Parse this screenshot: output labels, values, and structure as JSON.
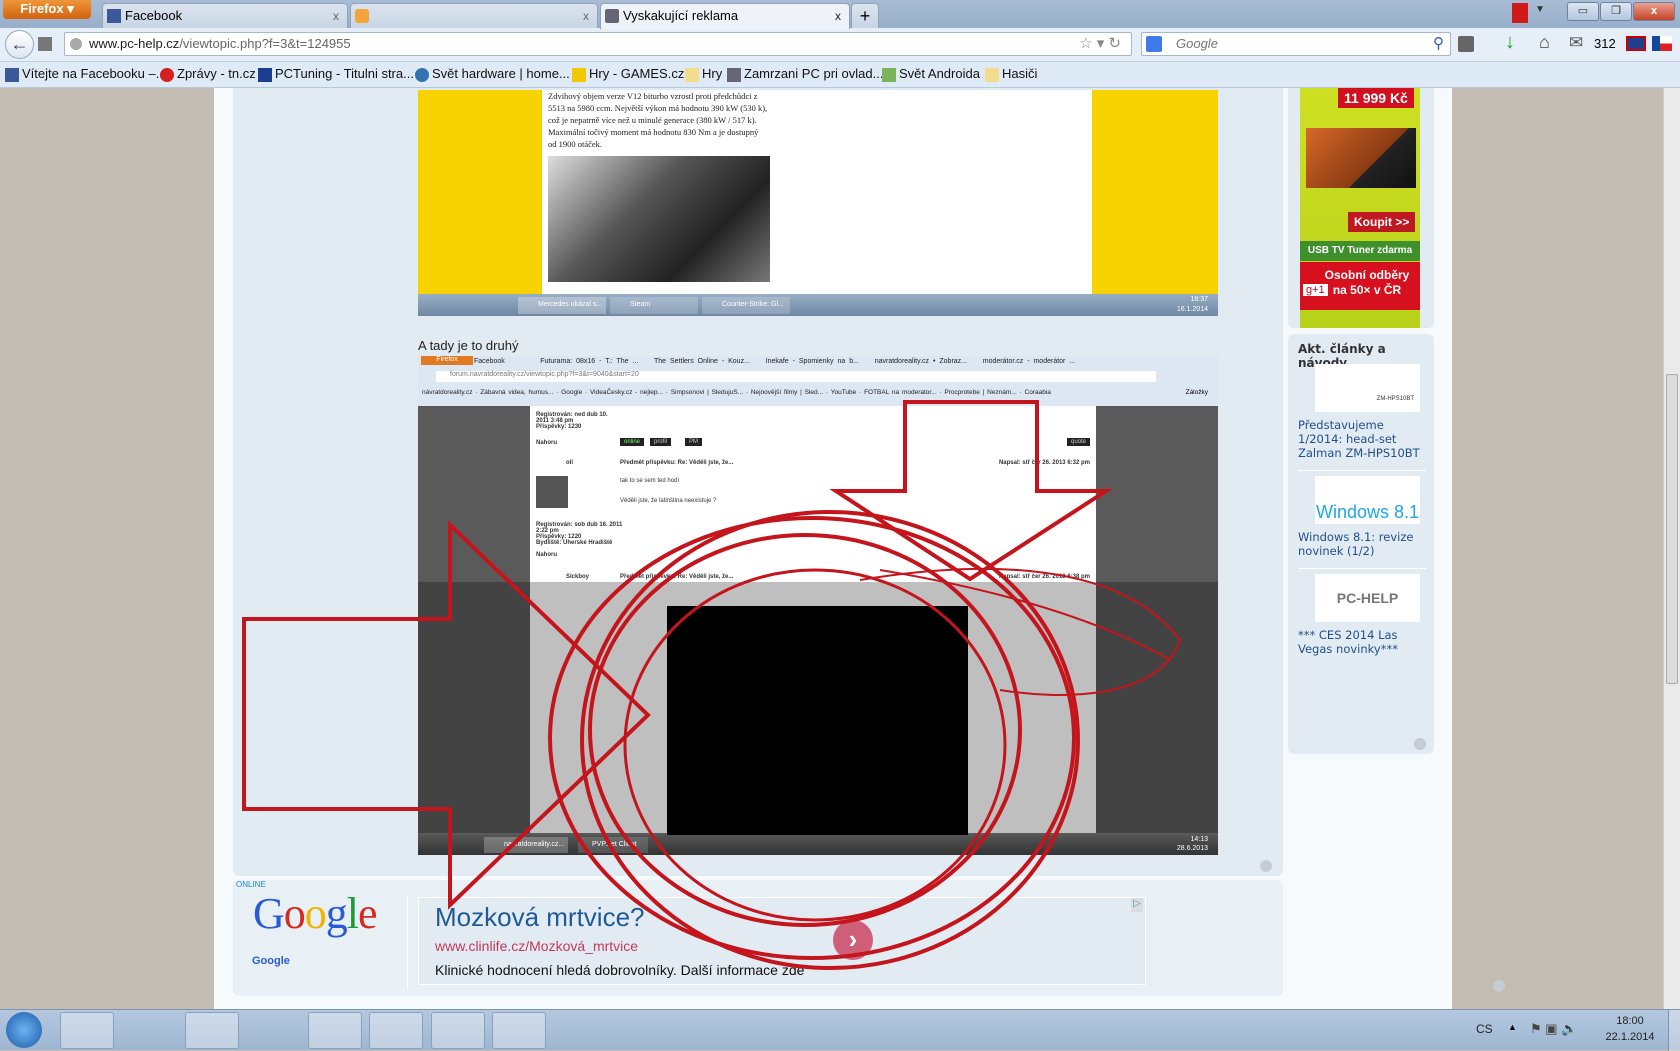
{
  "browser": {
    "menu_button": "Firefox",
    "tabs": [
      {
        "label": "Facebook"
      },
      {
        "label": ""
      },
      {
        "label": "Vyskakující reklama"
      }
    ],
    "new_tab": "+",
    "url_domain": "www.pc-help.cz",
    "url_path": "/viewtopic.php?f=3&t=124955",
    "search_placeholder": "Google",
    "mail_count": "312",
    "bookmarks": [
      "Vítejte na Facebooku –...",
      "Zprávy - tn.cz",
      "PCTuning - Titulni stra...",
      "Svět hardware | home...",
      "Hry - GAMES.cz",
      "Hry",
      "Zamrzani PC pri ovlad...",
      "Svět Androida",
      "Hasiči"
    ]
  },
  "post": {
    "shot1_text": "Zdvihový objem verze V12 biturbo vzrostl proti předchůdci z 5513 na 5980 ccm. Největší výkon má hodnotu 390 kW (530 k), což je nepatrně více než u minulé generace (380 kW / 517 k). Maximální točivý moment má hodnotu 830 Nm a je dostupný od 1900 otáček.",
    "shot1_taskbar": [
      "Mercedes ukázal s...",
      "Steam",
      "Counter-Strike: Gl..."
    ],
    "shot1_clock": "18:37",
    "shot1_date": "16.1.2014",
    "caption": "A tady je to druhý",
    "shot2_tabs": [
      "Facebook",
      "Futurama: 08x16 - T.: The ...",
      "The Settlers Online - Kouz...",
      "Inekafe - Spomienky na b...",
      "navratdoreality.cz • Zobraz...",
      "moderátor.cz - moderátor ..."
    ],
    "shot2_url": "forum.navratdoreality.cz/viewtopic.php?f=3&t=9040&start=20",
    "shot2_bookmarks": [
      "návratdoreality.cz",
      "Zábavná videa, humus...",
      "Google",
      "VideaČesky.cz - nejlep...",
      "Simpsonovi | SledujuS...",
      "Nejnovější filmy | Sled...",
      "YouTube",
      "FOTBAL na moderator...",
      "Procprotebe | Neznám...",
      "Coraabia",
      "Záložky"
    ],
    "shot2_posts": [
      {
        "author": "",
        "reg": "Registrován: ned dub 10. 2011 3:48 pm",
        "posts": "Příspěvky: 1230",
        "top": "Nahoru"
      },
      {
        "author": "oli",
        "subject": "Předmět příspěvku: Re: Věděli jste, že...",
        "date": "Napsal: stř čer 26. 2013 6:32 pm",
        "body1": "tak to se sem ted hodí",
        "body2": "Věděli jste, že latinština neexistuje ?",
        "reg": "Registrován: sob dub 16. 2011 2:22 pm",
        "posts": "Příspěvky: 1220",
        "loc": "Bydliště: Uherské Hradiště",
        "top": "Nahoru"
      },
      {
        "author": "Sickboy",
        "subject": "Předmět příspěvku: Re: Věděli jste, že...",
        "date": "Napsal: stř čer 26. 2013 6:38 pm"
      }
    ],
    "shot2_buttons": [
      "online",
      "profil",
      "PM",
      "quote"
    ],
    "shot2_clock": "14:13",
    "shot2_date": "28.6.2013",
    "shot2_taskbar": [
      "navratdoreality.cz...",
      "PVP.net Client"
    ]
  },
  "sidebar": {
    "ad_price": "11 999 Kč",
    "ad_buy": "Koupit >>",
    "ad_tuner": "USB TV Tuner zdarma",
    "ad_pickup": "Osobní odběry na 50× v ČR",
    "gplus": "g+1",
    "heading": "Akt. články a návody",
    "articles": [
      {
        "title": "Představujeme 1/2014: head-set Zalman ZM-HPS10BT",
        "thumb": "ZM-HPS10BT"
      },
      {
        "title": "Windows 8.1: revize novinek (1/2)",
        "thumb": "Windows 8.1"
      },
      {
        "title": "*** CES 2014 Las Vegas novinky***",
        "thumb": "PC-HELP"
      }
    ]
  },
  "google_ad": {
    "online": "ONLINE",
    "logo": "Google",
    "small_logo": "Google",
    "title": "Mozková mrtvice?",
    "url": "www.clinlife.cz/Mozková_mrtvice",
    "text": "Klinické hodnocení hledá dobrovolníky. Další informace zde"
  },
  "taskbar": {
    "lang": "CS",
    "time": "18:00",
    "date": "22.1.2014"
  }
}
